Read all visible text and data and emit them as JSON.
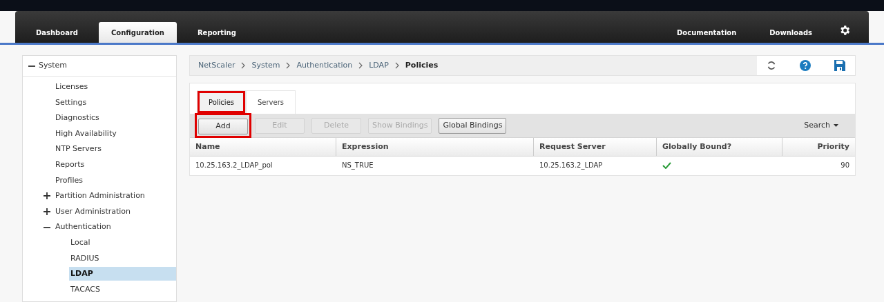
{
  "nav": {
    "tabs": [
      {
        "label": "Dashboard",
        "selected": false
      },
      {
        "label": "Configuration",
        "selected": true
      },
      {
        "label": "Reporting",
        "selected": false
      }
    ],
    "links": [
      "Documentation",
      "Downloads"
    ]
  },
  "sidebar": {
    "items": [
      {
        "label": "System",
        "expanded": true,
        "selected": false,
        "children": [
          {
            "label": "Licenses",
            "selected": false
          },
          {
            "label": "Settings",
            "selected": false
          },
          {
            "label": "Diagnostics",
            "selected": false
          },
          {
            "label": "High Availability",
            "selected": false
          },
          {
            "label": "NTP Servers",
            "selected": false
          },
          {
            "label": "Reports",
            "selected": false
          },
          {
            "label": "Profiles",
            "selected": false
          },
          {
            "label": "Partition Administration",
            "expanded": false,
            "selected": false
          },
          {
            "label": "User Administration",
            "expanded": false,
            "selected": false
          },
          {
            "label": "Authentication",
            "expanded": true,
            "selected": false,
            "children": [
              {
                "label": "Local",
                "selected": false
              },
              {
                "label": "RADIUS",
                "selected": false
              },
              {
                "label": "LDAP",
                "selected": true
              },
              {
                "label": "TACACS",
                "selected": false
              }
            ]
          }
        ]
      }
    ]
  },
  "breadcrumb": [
    "NetScaler",
    "System",
    "Authentication",
    "LDAP",
    "Policies"
  ],
  "tabs": [
    {
      "label": "Policies",
      "selected": true,
      "highlighted": true
    },
    {
      "label": "Servers",
      "selected": false,
      "highlighted": false
    }
  ],
  "toolbar": {
    "buttons": [
      {
        "label": "Add",
        "disabled": false,
        "highlighted": true
      },
      {
        "label": "Edit",
        "disabled": true,
        "highlighted": false
      },
      {
        "label": "Delete",
        "disabled": true,
        "highlighted": false
      },
      {
        "label": "Show Bindings",
        "disabled": true,
        "highlighted": false
      },
      {
        "label": "Global Bindings",
        "disabled": false,
        "highlighted": false
      }
    ],
    "search": "Search"
  },
  "table": {
    "columns": [
      "Name",
      "Expression",
      "Request Server",
      "Globally Bound?",
      "Priority"
    ],
    "rows": [
      {
        "cells": [
          "10.25.163.2_LDAP_pol",
          "NS_TRUE",
          "10.25.163.2_LDAP"
        ],
        "globally_bound": true,
        "priority": "90"
      }
    ]
  }
}
